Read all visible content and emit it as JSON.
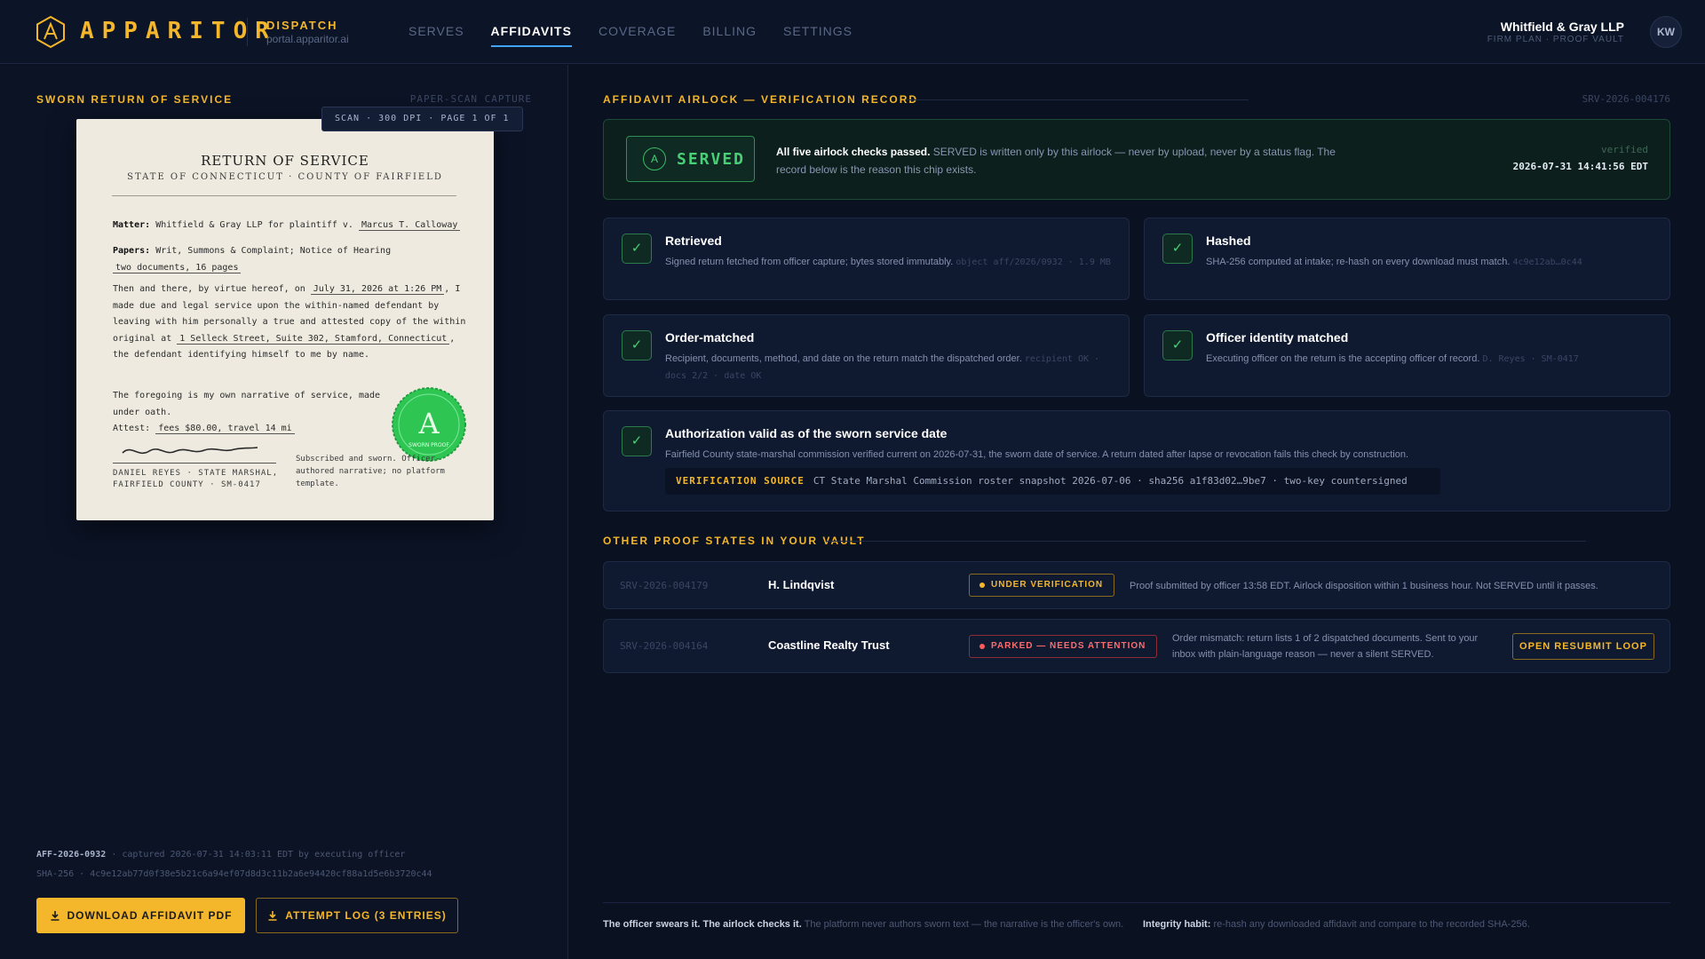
{
  "header": {
    "brand": "APPARITOR",
    "brand_initial": "A",
    "product": "DISPATCH",
    "portal_url": "portal.apparitor.ai",
    "nav": [
      {
        "label": "SERVES",
        "active": false
      },
      {
        "label": "AFFIDAVITS",
        "active": true
      },
      {
        "label": "COVERAGE",
        "active": false
      },
      {
        "label": "BILLING",
        "active": false
      },
      {
        "label": "SETTINGS",
        "active": false
      }
    ],
    "firm_name": "Whitfield & Gray LLP",
    "firm_plan": "FIRM PLAN · PROOF VAULT",
    "avatar_initials": "KW"
  },
  "left": {
    "section_title": "SWORN RETURN OF SERVICE",
    "capture_label": "PAPER-SCAN CAPTURE",
    "scan_badge": "SCAN · 300 DPI · PAGE 1 OF 1",
    "document": {
      "title": "RETURN OF SERVICE",
      "subtitle": "STATE OF CONNECTICUT · COUNTY OF FAIRFIELD",
      "matter_label": "Matter:",
      "matter_text": "Whitfield & Gray LLP for plaintiff v.",
      "defendant": "Marcus T. Calloway",
      "papers_label": "Papers:",
      "papers_text": "Writ, Summons & Complaint; Notice of Hearing",
      "papers_count": "two documents, 16 pages",
      "narrative_1": "Then and there, by virtue hereof, on",
      "service_datetime": "July 31, 2026 at 1:26 PM",
      "narrative_2": ", I made due and legal service upon the within-named defendant by leaving with him personally a true and attested copy of the within original at",
      "address": "1 Selleck Street, Suite 302, Stamford, Connecticut",
      "narrative_3": ", the defendant identifying himself to me by name.",
      "foregoing": "The foregoing is my own narrative of service, made under oath.",
      "attest_label": "Attest:",
      "fees": "fees $80.00, travel 14 mi",
      "seal_letter": "A",
      "seal_text": "SWORN PROOF",
      "officer_line_1": "DANIEL REYES · STATE MARSHAL,",
      "officer_line_2": "FAIRFIELD COUNTY · SM-0417",
      "sworn_note": "Subscribed and sworn. Officer-authored narrative; no platform template."
    },
    "affidavit_id": "AFF-2026-0932",
    "captured_text": "· captured 2026-07-31 14:03:11 EDT by executing officer",
    "sha_label": "SHA-256",
    "sha_value": "· 4c9e12ab77d0f38e5b21c6a94ef07d8d3c11b2a6e94420cf88a1d5e6b3720c44",
    "download_button": "DOWNLOAD AFFIDAVIT PDF",
    "attempt_log_button": "ATTEMPT LOG (3 ENTRIES)"
  },
  "right": {
    "section_title": "AFFIDAVIT AIRLOCK — VERIFICATION RECORD",
    "srv_id": "SRV-2026-004176",
    "served": {
      "chip_letter": "A",
      "chip_label": "SERVED",
      "bold": "All five airlock checks passed.",
      "text": "SERVED is written only by this airlock — never by upload, never by a status flag. The record below is the reason this chip exists.",
      "verified_label": "verified",
      "verified_ts": "2026-07-31 14:41:56 EDT"
    },
    "checks": [
      {
        "title": "Retrieved",
        "desc": "Signed return fetched from officer capture; bytes stored immutably.",
        "meta": "object aff/2026/0932 · 1.9 MB"
      },
      {
        "title": "Hashed",
        "desc": "SHA-256 computed at intake; re-hash on every download must match.",
        "meta": "4c9e12ab…0c44"
      },
      {
        "title": "Order-matched",
        "desc": "Recipient, documents, method, and date on the return match the dispatched order.",
        "meta": "recipient OK · docs 2/2 · date OK"
      },
      {
        "title": "Officer identity matched",
        "desc": "Executing officer on the return is the accepting officer of record.",
        "meta": "D. Reyes · SM-0417"
      }
    ],
    "authorization": {
      "title": "Authorization valid as of the sworn service date",
      "desc": "Fairfield County state-marshal commission verified current on 2026-07-31, the sworn date of service. A return dated after lapse or revocation fails this check by construction.",
      "source_label": "VERIFICATION SOURCE",
      "source_text": "CT State Marshal Commission roster snapshot 2026-07-06 · sha256 a1f83d02…9be7 · two-key countersigned"
    },
    "vault_title": "OTHER PROOF STATES IN YOUR VAULT",
    "vault": [
      {
        "id": "SRV-2026-004179",
        "name": "H. Lindqvist",
        "status": "UNDER VERIFICATION",
        "desc": "Proof submitted by officer 13:58 EDT. Airlock disposition within 1 business hour. Not SERVED until it passes."
      },
      {
        "id": "SRV-2026-004164",
        "name": "Coastline Realty Trust",
        "status": "PARKED — NEEDS ATTENTION",
        "desc": "Order mismatch: return lists 1 of 2 dispatched documents. Sent to your inbox with plain-language reason — never a silent SERVED.",
        "action": "OPEN RESUBMIT LOOP"
      }
    ],
    "footer": {
      "a_bold": "The officer swears it. The airlock checks it.",
      "a_text": "The platform never authors sworn text — the narrative is the officer's own.",
      "b_bold": "Integrity habit:",
      "b_text": "re-hash any downloaded affidavit and compare to the recorded SHA-256."
    }
  },
  "colors": {
    "accent": "#f4b62b",
    "success": "#48d077",
    "danger": "#ff6b6b",
    "link_active": "#3fa5ff",
    "background": "#0a1121"
  }
}
